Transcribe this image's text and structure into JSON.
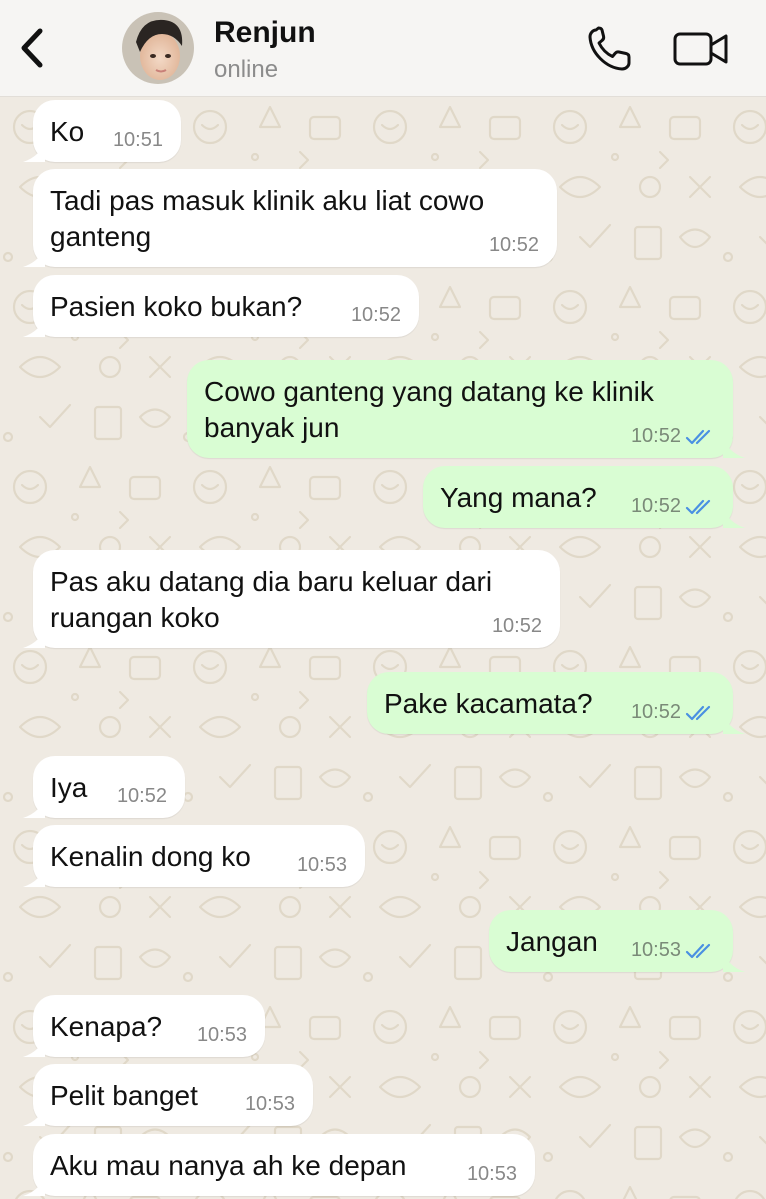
{
  "header": {
    "contact_name": "Renjun",
    "contact_status": "online",
    "back_icon": "chevron-left-icon",
    "call_icon": "phone-icon",
    "video_icon": "video-camera-icon"
  },
  "colors": {
    "incoming_bubble": "#ffffff",
    "outgoing_bubble": "#d9fdd3",
    "read_ticks": "#4a90e2",
    "wallpaper": "#efeae2"
  },
  "messages": [
    {
      "direction": "incoming",
      "text": "Ko",
      "time": "10:51"
    },
    {
      "direction": "incoming",
      "text": "Tadi pas masuk klinik aku liat cowo\nganteng",
      "time": "10:52"
    },
    {
      "direction": "incoming",
      "text": "Pasien koko bukan?",
      "time": "10:52"
    },
    {
      "direction": "outgoing",
      "text": "Cowo ganteng yang datang ke klinik\nbanyak jun",
      "time": "10:52",
      "status": "read"
    },
    {
      "direction": "outgoing",
      "text": "Yang mana?",
      "time": "10:52",
      "status": "read"
    },
    {
      "direction": "incoming",
      "text": "Pas aku datang dia baru keluar dari\nruangan koko",
      "time": "10:52"
    },
    {
      "direction": "outgoing",
      "text": "Pake kacamata?",
      "time": "10:52",
      "status": "read"
    },
    {
      "direction": "incoming",
      "text": "Iya",
      "time": "10:52"
    },
    {
      "direction": "incoming",
      "text": "Kenalin dong ko",
      "time": "10:53"
    },
    {
      "direction": "outgoing",
      "text": "Jangan",
      "time": "10:53",
      "status": "read"
    },
    {
      "direction": "incoming",
      "text": "Kenapa?",
      "time": "10:53"
    },
    {
      "direction": "incoming",
      "text": "Pelit banget",
      "time": "10:53"
    },
    {
      "direction": "incoming",
      "text": "Aku mau nanya ah ke depan",
      "time": "10:53"
    }
  ]
}
